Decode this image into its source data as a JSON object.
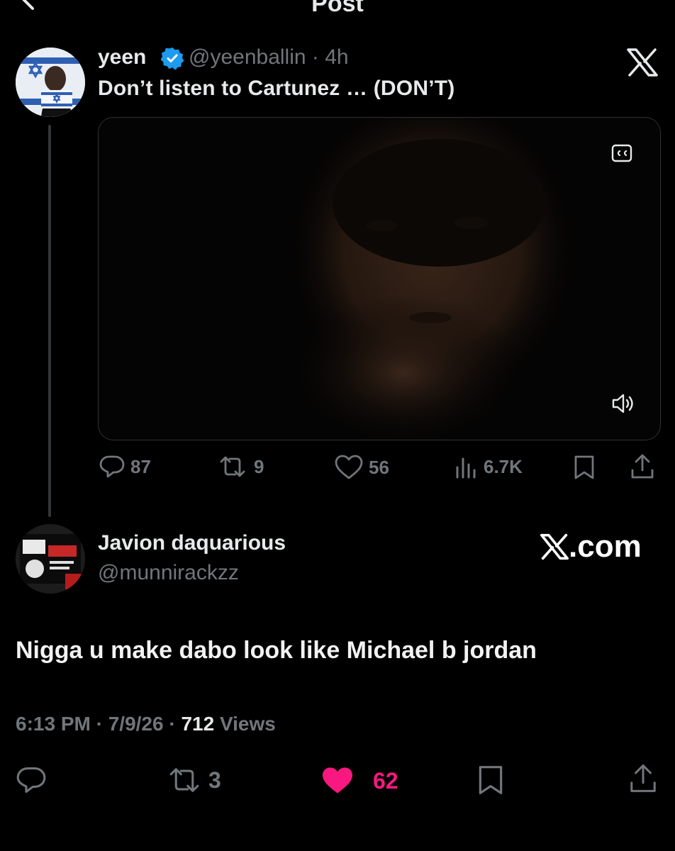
{
  "header": {
    "title": "Post"
  },
  "parent": {
    "name": "yeen",
    "handle": "@yeenballin",
    "sep": "·",
    "time": "4h",
    "text": "Don’t listen to Cartunez … (DON’T)",
    "stats": {
      "replies": "87",
      "reposts": "9",
      "likes": "56",
      "views": "6.7K"
    }
  },
  "reply": {
    "name": "Javion daquarious",
    "handle": "@munnirackzz",
    "brand": ".com",
    "text": "Nigga u make dabo look like Michael b jordan",
    "time": "6:13 PM",
    "date": "7/9/26",
    "sep": "·",
    "views_count": "712",
    "views_label": "Views",
    "stats": {
      "reposts": "3",
      "likes": "62"
    }
  },
  "colors": {
    "like_active": "#f91880",
    "verified": "#1d9bf0",
    "muted": "#71767b",
    "background": "#000000"
  },
  "icons": [
    "back-arrow-icon",
    "more-icon",
    "verified-badge-icon",
    "x-logo-icon",
    "closed-captions-icon",
    "volume-icon",
    "reply-icon",
    "repost-icon",
    "like-icon",
    "views-icon",
    "bookmark-icon",
    "share-icon"
  ]
}
